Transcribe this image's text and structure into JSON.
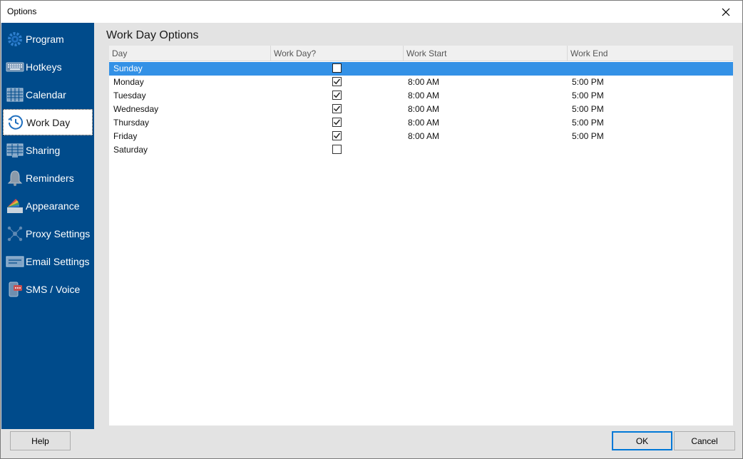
{
  "window": {
    "title": "Options"
  },
  "sidebar": {
    "items": [
      {
        "label": "Program",
        "icon": "gear-icon"
      },
      {
        "label": "Hotkeys",
        "icon": "keyboard-icon"
      },
      {
        "label": "Calendar",
        "icon": "calendar-icon"
      },
      {
        "label": "Work Day",
        "icon": "clock-icon",
        "active": true
      },
      {
        "label": "Sharing",
        "icon": "sharing-icon"
      },
      {
        "label": "Reminders",
        "icon": "bell-icon"
      },
      {
        "label": "Appearance",
        "icon": "palette-icon"
      },
      {
        "label": "Proxy Settings",
        "icon": "network-icon"
      },
      {
        "label": "Email Settings",
        "icon": "email-icon"
      },
      {
        "label": "SMS / Voice",
        "icon": "phone-icon"
      }
    ]
  },
  "main": {
    "title": "Work Day Options",
    "columns": [
      "Day",
      "Work Day?",
      "Work Start",
      "Work End"
    ],
    "rows": [
      {
        "day": "Sunday",
        "work_day": false,
        "start": "",
        "end": "",
        "selected": true
      },
      {
        "day": "Monday",
        "work_day": true,
        "start": "8:00 AM",
        "end": "5:00 PM"
      },
      {
        "day": "Tuesday",
        "work_day": true,
        "start": "8:00 AM",
        "end": "5:00 PM"
      },
      {
        "day": "Wednesday",
        "work_day": true,
        "start": "8:00 AM",
        "end": "5:00 PM"
      },
      {
        "day": "Thursday",
        "work_day": true,
        "start": "8:00 AM",
        "end": "5:00 PM"
      },
      {
        "day": "Friday",
        "work_day": true,
        "start": "8:00 AM",
        "end": "5:00 PM"
      },
      {
        "day": "Saturday",
        "work_day": false,
        "start": "",
        "end": ""
      }
    ]
  },
  "footer": {
    "help_label": "Help",
    "ok_label": "OK",
    "cancel_label": "Cancel"
  },
  "colors": {
    "sidebar": "#004b8b",
    "selection": "#3391e6",
    "accent": "#0078d7"
  }
}
